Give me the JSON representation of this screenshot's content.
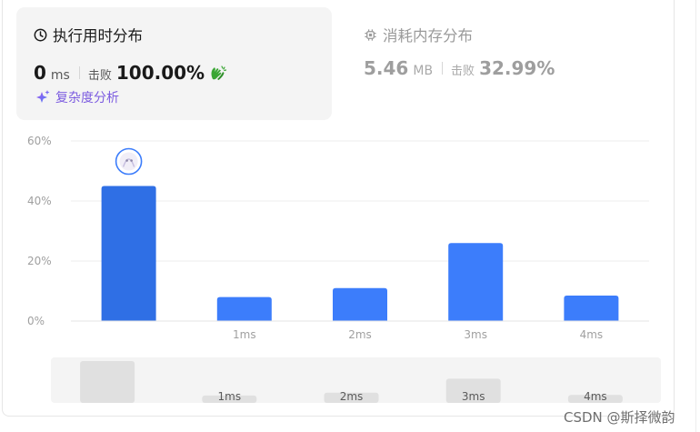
{
  "runtime": {
    "title": "执行用时分布",
    "value": "0",
    "unit": "ms",
    "beats_label": "击败",
    "beats_percent": "100.00%"
  },
  "complexity_link": {
    "label": "复杂度分析"
  },
  "memory": {
    "title": "消耗内存分布",
    "value": "5.46",
    "unit": "MB",
    "beats_label": "击败",
    "beats_percent": "32.99%"
  },
  "chart_data": {
    "type": "bar",
    "categories": [
      "0ms",
      "1ms",
      "2ms",
      "3ms",
      "4ms"
    ],
    "x_tick_labels": [
      "",
      "1ms",
      "2ms",
      "3ms",
      "4ms"
    ],
    "values": [
      45,
      8,
      11,
      26,
      8.5
    ],
    "y_ticks": [
      "0%",
      "20%",
      "40%",
      "60%"
    ],
    "ylim": [
      0,
      60
    ],
    "grid": true,
    "highlighted_index": 0,
    "colors": {
      "highlight": "#2f6fe5",
      "bar": "#3c7dfb"
    }
  },
  "range_slider": {
    "labels": [
      "",
      "1ms",
      "2ms",
      "3ms",
      "4ms"
    ],
    "values": [
      45,
      8,
      11,
      26,
      8.5
    ]
  },
  "watermark": "CSDN @斯择微韵",
  "colors": {
    "panel_bg": "#f4f4f4",
    "accent_purple": "#7c5ce0",
    "hand_green": "#3aa634"
  }
}
